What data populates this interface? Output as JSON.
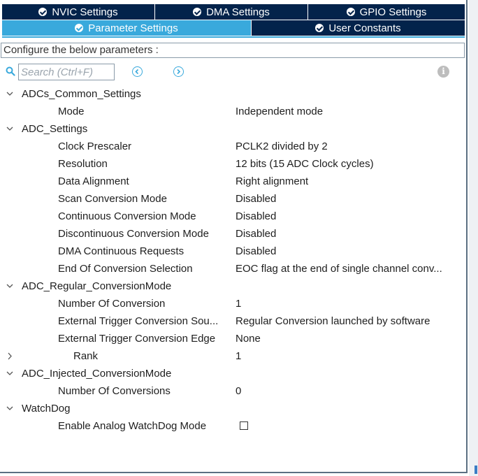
{
  "tabs_row1": [
    {
      "label": "NVIC Settings",
      "active": false
    },
    {
      "label": "DMA Settings",
      "active": false
    },
    {
      "label": "GPIO Settings",
      "active": false
    }
  ],
  "tabs_row2": [
    {
      "label": "Parameter Settings",
      "active": true
    },
    {
      "label": "User Constants",
      "active": false
    }
  ],
  "config_label": "Configure the below parameters :",
  "search": {
    "placeholder": "Search (Ctrl+F)"
  },
  "colors": {
    "tab_dark": "#03234b",
    "tab_active": "#39a9dc"
  },
  "tree": {
    "groups": [
      {
        "label": "ADCs_Common_Settings",
        "params": [
          {
            "name": "Mode",
            "value": "Independent mode"
          }
        ]
      },
      {
        "label": "ADC_Settings",
        "params": [
          {
            "name": "Clock Prescaler",
            "value": "PCLK2 divided by 2"
          },
          {
            "name": "Resolution",
            "value": "12 bits (15 ADC Clock cycles)"
          },
          {
            "name": "Data Alignment",
            "value": "Right alignment"
          },
          {
            "name": "Scan Conversion Mode",
            "value": "Disabled"
          },
          {
            "name": "Continuous Conversion Mode",
            "value": "Disabled"
          },
          {
            "name": "Discontinuous Conversion Mode",
            "value": "Disabled"
          },
          {
            "name": "DMA Continuous Requests",
            "value": "Disabled"
          },
          {
            "name": "End Of Conversion Selection",
            "value": "EOC flag at the end of single channel conv..."
          }
        ]
      },
      {
        "label": "ADC_Regular_ConversionMode",
        "params": [
          {
            "name": "Number Of Conversion",
            "value": "1"
          },
          {
            "name": "External Trigger Conversion Sou...",
            "value": "Regular Conversion launched by software"
          },
          {
            "name": "External Trigger Conversion Edge",
            "value": "None"
          },
          {
            "name": "Rank",
            "value": "1"
          }
        ]
      },
      {
        "label": "ADC_Injected_ConversionMode",
        "params": [
          {
            "name": "Number Of Conversions",
            "value": "0"
          }
        ]
      },
      {
        "label": "WatchDog",
        "params": [
          {
            "name": "Enable Analog WatchDog Mode",
            "value": "",
            "checked": false
          }
        ]
      }
    ]
  }
}
